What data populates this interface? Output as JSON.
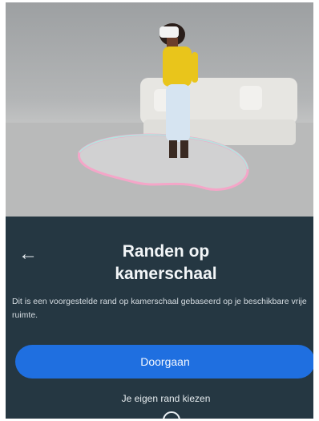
{
  "hero": {
    "alt_icon": "avatar-in-room-illustration"
  },
  "panel": {
    "back_icon": "arrow-left-icon",
    "title": "Randen op kamerschaal",
    "description": "Dit is een voorgestelde rand op kamerschaal gebaseerd op je beschikbare vrije ruimte.",
    "primary_button": "Doorgaan",
    "secondary_link": "Je eigen rand kiezen",
    "home_icon": "circle-home-icon"
  },
  "colors": {
    "panel_bg": "#253742",
    "accent": "#1f6fe0"
  }
}
